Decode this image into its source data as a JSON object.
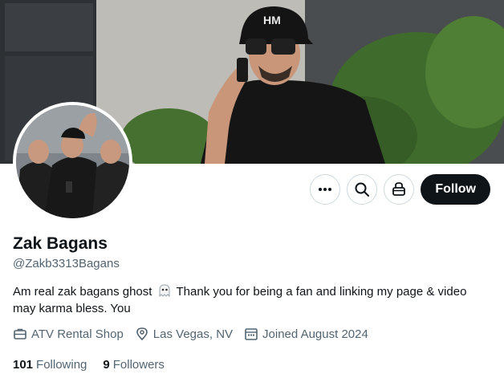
{
  "profile": {
    "name": "Zak Bagans",
    "handle": "@Zakb3313Bagans",
    "bio_part1": "Am real zak bagans ghost",
    "bio_emoji": "ghost-emoji",
    "bio_part2": "Thank you for being a fan and linking my page & video may karma bless. You",
    "category": "ATV Rental Shop",
    "location": "Las Vegas, NV",
    "joined": "Joined August 2024"
  },
  "stats": {
    "following_count": "101",
    "following_label": "Following",
    "followers_count": "9",
    "followers_label": "Followers"
  },
  "actions": {
    "follow_label": "Follow",
    "more_icon": "more-dots-icon",
    "search_icon": "search-icon",
    "shop_icon": "shop-icon"
  },
  "colors": {
    "follow_bg": "#0f1419",
    "secondary_text": "#536471",
    "border": "#cfd9de"
  }
}
